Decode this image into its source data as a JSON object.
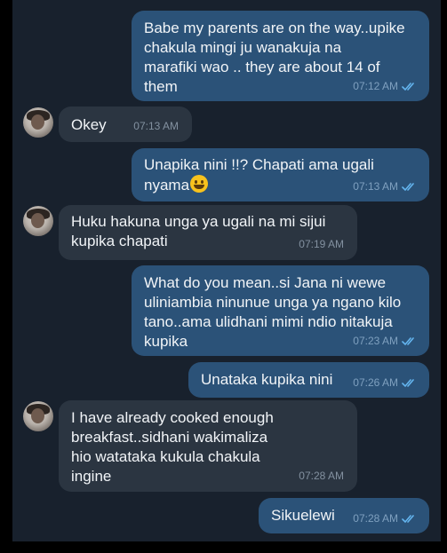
{
  "messages": [
    {
      "dir": "out",
      "text": "Babe my parents are on the way..upike\nchakula mingi ju wanakuja na\nmarafiki wao .. they are about 14 of\nthem",
      "time": "07:12 AM",
      "read_icon": "double-check-icon"
    },
    {
      "dir": "in",
      "text": "Okey",
      "time": "07:13 AM"
    },
    {
      "dir": "out",
      "text": "Unapika nini !!? Chapati ama ugali\nnyama",
      "emoji": "grinning-face-emoji",
      "time": "07:13 AM",
      "read_icon": "double-check-icon"
    },
    {
      "dir": "in",
      "text": "Huku hakuna unga ya ugali na mi sijui\nkupika chapati",
      "time": "07:19 AM"
    },
    {
      "dir": "out",
      "text": "What do you mean..si Jana ni wewe\nuliniambia ninunue unga ya ngano kilo\ntano..ama ulidhani mimi ndio nitakuja\nkupika",
      "time": "07:23 AM",
      "read_icon": "double-check-icon"
    },
    {
      "dir": "out",
      "text": "Unataka kupika nini",
      "time": "07:26 AM",
      "read_icon": "double-check-icon"
    },
    {
      "dir": "in",
      "text": "I have already cooked enough\nbreakfast..sidhani wakimaliza\nhio watataka kukula chakula\ningine",
      "time": "07:28 AM"
    },
    {
      "dir": "out",
      "text": "Sikuelewi",
      "time": "07:28 AM",
      "read_icon": "double-check-icon"
    }
  ],
  "colors": {
    "background": "#18212d",
    "outgoing_bubble": "#2b5278",
    "incoming_bubble": "#2b3541",
    "read_tick": "#64b5ef"
  }
}
